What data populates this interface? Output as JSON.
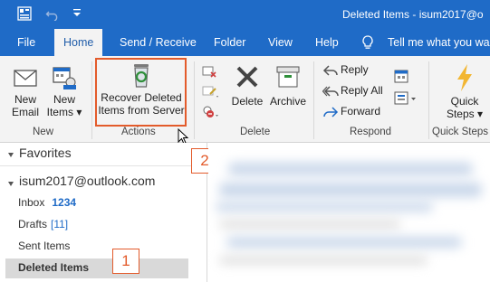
{
  "window": {
    "title": "Deleted Items - isum2017@o"
  },
  "tabs": {
    "file": "File",
    "home": "Home",
    "send_receive": "Send / Receive",
    "folder": "Folder",
    "view": "View",
    "help": "Help",
    "tell_me": "Tell me what you wan"
  },
  "ribbon": {
    "new_group": {
      "label": "New",
      "new_email": [
        "New",
        "Email"
      ],
      "new_items": [
        "New",
        "Items ▾"
      ]
    },
    "actions_group": {
      "label": "Actions",
      "recover": [
        "Recover Deleted",
        "Items from Server"
      ]
    },
    "delete_group": {
      "label": "Delete",
      "delete": "Delete",
      "archive": "Archive"
    },
    "respond_group": {
      "label": "Respond",
      "reply": "Reply",
      "reply_all": "Reply All",
      "forward": "Forward"
    },
    "quicksteps_group": {
      "label": "Quick Steps",
      "quick_steps": [
        "Quick",
        "Steps ▾"
      ]
    }
  },
  "folders": {
    "favorites": "Favorites",
    "account": "isum2017@outlook.com",
    "inbox": {
      "label": "Inbox",
      "count": "1234"
    },
    "drafts": {
      "label": "Drafts",
      "count": "[11]"
    },
    "sent": "Sent Items",
    "deleted": "Deleted Items"
  },
  "callouts": {
    "one": "1",
    "two": "2"
  },
  "colors": {
    "brand": "#1f6bc7",
    "highlight": "#e35b2b"
  }
}
